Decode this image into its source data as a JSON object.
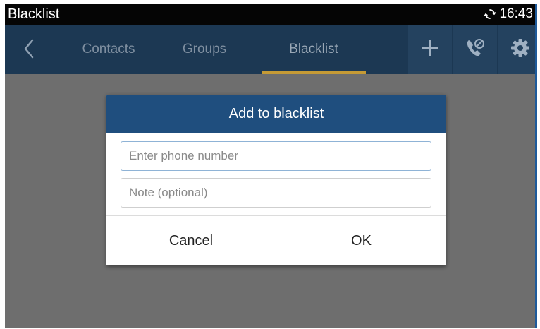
{
  "status_bar": {
    "app_title": "Blacklist",
    "time": "16:43",
    "sync_icon": "sync-icon"
  },
  "nav": {
    "back_icon": "chevron-left-icon",
    "tabs": [
      {
        "label": "Contacts",
        "active": false
      },
      {
        "label": "Groups",
        "active": false
      },
      {
        "label": "Blacklist",
        "active": true
      }
    ],
    "actions": [
      {
        "icon": "plus-icon",
        "name": "add"
      },
      {
        "icon": "call-block-icon",
        "name": "call-block"
      },
      {
        "icon": "gear-icon",
        "name": "settings"
      }
    ]
  },
  "dialog": {
    "title": "Add to blacklist",
    "phone_field": {
      "placeholder": "Enter phone number",
      "value": ""
    },
    "note_field": {
      "placeholder": "Note (optional)",
      "value": ""
    },
    "cancel_label": "Cancel",
    "ok_label": "OK"
  },
  "colors": {
    "status_bar_bg": "#050505",
    "nav_bg": "#1c3853",
    "dialog_header_bg": "#1f4e7e",
    "tab_indicator": "#c59a35",
    "overlay": "#6e6e6e"
  }
}
